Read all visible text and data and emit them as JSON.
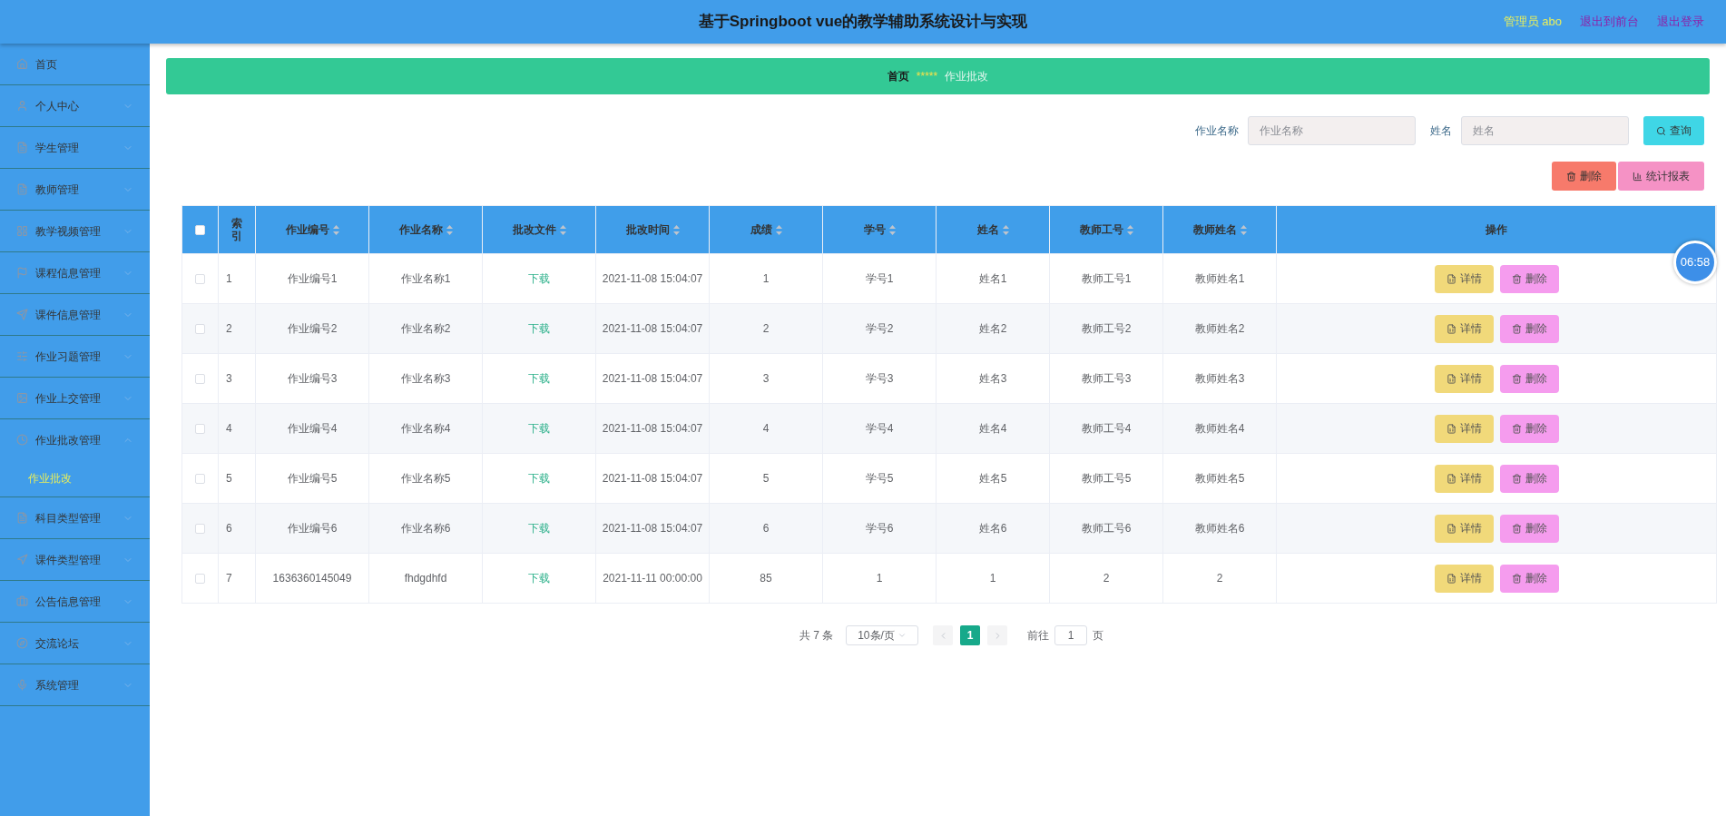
{
  "header": {
    "title": "基于Springboot vue的教学辅助系统设计与实现",
    "user": "管理员 abo",
    "links": [
      "退出到前台",
      "退出登录"
    ]
  },
  "sidebar": {
    "items": [
      {
        "label": "首页",
        "kind": "link"
      },
      {
        "label": "个人中心",
        "kind": "menu",
        "expanded": false
      },
      {
        "label": "学生管理",
        "kind": "menu",
        "expanded": false
      },
      {
        "label": "教师管理",
        "kind": "menu",
        "expanded": false
      },
      {
        "label": "教学视频管理",
        "kind": "menu",
        "expanded": false
      },
      {
        "label": "课程信息管理",
        "kind": "menu",
        "expanded": false
      },
      {
        "label": "课件信息管理",
        "kind": "menu",
        "expanded": false
      },
      {
        "label": "作业习题管理",
        "kind": "menu",
        "expanded": false
      },
      {
        "label": "作业上交管理",
        "kind": "menu",
        "expanded": false
      },
      {
        "label": "作业批改管理",
        "kind": "menu",
        "expanded": true,
        "children": [
          {
            "label": "作业批改",
            "selected": true
          }
        ]
      },
      {
        "label": "科目类型管理",
        "kind": "menu",
        "expanded": false
      },
      {
        "label": "课件类型管理",
        "kind": "menu",
        "expanded": false
      },
      {
        "label": "公告信息管理",
        "kind": "menu",
        "expanded": false
      },
      {
        "label": "交流论坛",
        "kind": "menu",
        "expanded": false
      },
      {
        "label": "系统管理",
        "kind": "menu",
        "expanded": false
      }
    ]
  },
  "breadcrumb": {
    "items": [
      "首页",
      "作业批改"
    ],
    "separator": "*****"
  },
  "search": {
    "fields": [
      {
        "label": "作业名称",
        "placeholder": "作业名称"
      },
      {
        "label": "姓名",
        "placeholder": "姓名"
      }
    ],
    "button": "查询"
  },
  "actions": [
    "删除",
    "统计报表"
  ],
  "table": {
    "all_checked": false,
    "columns": [
      {
        "label": "索引",
        "sortable": false
      },
      {
        "label": "作业编号",
        "sortable": true
      },
      {
        "label": "作业名称",
        "sortable": true
      },
      {
        "label": "批改文件",
        "sortable": true
      },
      {
        "label": "批改时间",
        "sortable": true
      },
      {
        "label": "成绩",
        "sortable": true
      },
      {
        "label": "学号",
        "sortable": true
      },
      {
        "label": "姓名",
        "sortable": true
      },
      {
        "label": "教师工号",
        "sortable": true
      },
      {
        "label": "教师姓名",
        "sortable": true
      },
      {
        "label": "操作",
        "sortable": false
      }
    ],
    "rows": [
      {
        "checked": false,
        "cells": [
          "1",
          "作业编号1",
          "作业名称1",
          "下载",
          "2021-11-08 15:04:07",
          "1",
          "学号1",
          "姓名1",
          "教师工号1",
          "教师姓名1"
        ],
        "buttons": [
          "详情",
          "删除"
        ]
      },
      {
        "checked": false,
        "cells": [
          "2",
          "作业编号2",
          "作业名称2",
          "下载",
          "2021-11-08 15:04:07",
          "2",
          "学号2",
          "姓名2",
          "教师工号2",
          "教师姓名2"
        ],
        "buttons": [
          "详情",
          "删除"
        ]
      },
      {
        "checked": false,
        "cells": [
          "3",
          "作业编号3",
          "作业名称3",
          "下载",
          "2021-11-08 15:04:07",
          "3",
          "学号3",
          "姓名3",
          "教师工号3",
          "教师姓名3"
        ],
        "buttons": [
          "详情",
          "删除"
        ]
      },
      {
        "checked": false,
        "cells": [
          "4",
          "作业编号4",
          "作业名称4",
          "下载",
          "2021-11-08 15:04:07",
          "4",
          "学号4",
          "姓名4",
          "教师工号4",
          "教师姓名4"
        ],
        "buttons": [
          "详情",
          "删除"
        ]
      },
      {
        "checked": false,
        "cells": [
          "5",
          "作业编号5",
          "作业名称5",
          "下载",
          "2021-11-08 15:04:07",
          "5",
          "学号5",
          "姓名5",
          "教师工号5",
          "教师姓名5"
        ],
        "buttons": [
          "详情",
          "删除"
        ]
      },
      {
        "checked": false,
        "cells": [
          "6",
          "作业编号6",
          "作业名称6",
          "下载",
          "2021-11-08 15:04:07",
          "6",
          "学号6",
          "姓名6",
          "教师工号6",
          "教师姓名6"
        ],
        "buttons": [
          "详情",
          "删除"
        ]
      },
      {
        "checked": false,
        "cells": [
          "7",
          "1636360145049",
          "fhdgdhfd",
          "下载",
          "2021-11-11 00:00:00",
          "85",
          "1",
          "1",
          "2",
          "2"
        ],
        "buttons": [
          "详情",
          "删除"
        ]
      }
    ]
  },
  "pagination": {
    "total": "共 7 条",
    "page_size": "10条/页",
    "pages": [
      {
        "label": "1",
        "selected": true
      }
    ],
    "goto_label": "前往",
    "goto_value": "1",
    "goto_suffix": "页"
  },
  "timer": "06:58"
}
